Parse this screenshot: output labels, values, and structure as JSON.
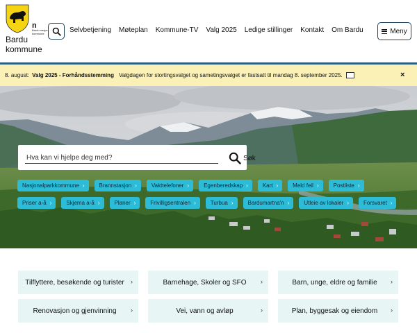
{
  "logo": {
    "name_line1": "Bardu",
    "name_line2": "kommune",
    "park_mark": "n",
    "park_text": "Bardu nasjonalpark-kommune",
    "shield_icon": "bear-shield-icon"
  },
  "header": {
    "nav": [
      {
        "label": "Selvbetjening"
      },
      {
        "label": "Møteplan"
      },
      {
        "label": "Kommune-TV"
      },
      {
        "label": "Valg 2025"
      },
      {
        "label": "Ledige stillinger"
      },
      {
        "label": "Kontakt"
      },
      {
        "label": "Om Bardu"
      }
    ],
    "menu_label": "Meny",
    "search_icon": "search-icon"
  },
  "alert": {
    "date": "8. august:",
    "title": "Valg 2025 - Forhåndsstemming",
    "text": "Valgdagen for stortingsvalget og sametingsvalget er fastsatt til mandag 8. september 2025.",
    "close": "×"
  },
  "search": {
    "placeholder": "Hva kan vi hjelpe deg med?",
    "submit_label": "Søk"
  },
  "quicklinks": [
    {
      "label": "Nasjonalparkkommune"
    },
    {
      "label": "Brannstasjon"
    },
    {
      "label": "Vakttelefoner"
    },
    {
      "label": "Egenberedskap"
    },
    {
      "label": "Kart"
    },
    {
      "label": "Meld feil"
    },
    {
      "label": "Postliste"
    },
    {
      "label": "Priser a-å"
    },
    {
      "label": "Skjema a-å"
    },
    {
      "label": "Planer"
    },
    {
      "label": "Frivilligsentralen"
    },
    {
      "label": "Turbua"
    },
    {
      "label": "Bardumartna'n"
    },
    {
      "label": "Utleie av lokaler"
    },
    {
      "label": "Forsvaret"
    }
  ],
  "categories": [
    {
      "label": "Tilflyttere, besøkende og turister"
    },
    {
      "label": "Barnehage, Skoler og SFO"
    },
    {
      "label": "Barn, unge, eldre og familie"
    },
    {
      "label": "Renovasjon og gjenvinning"
    },
    {
      "label": "Vei, vann og avløp"
    },
    {
      "label": "Plan, byggesak og eiendom"
    }
  ],
  "colors": {
    "brand_dark": "#1a3f5a",
    "accent_teal": "#2dbcd8",
    "alert_bg": "#fbf1b6",
    "category_bg": "#e7f6f5",
    "shield_yellow": "#f5d414"
  }
}
